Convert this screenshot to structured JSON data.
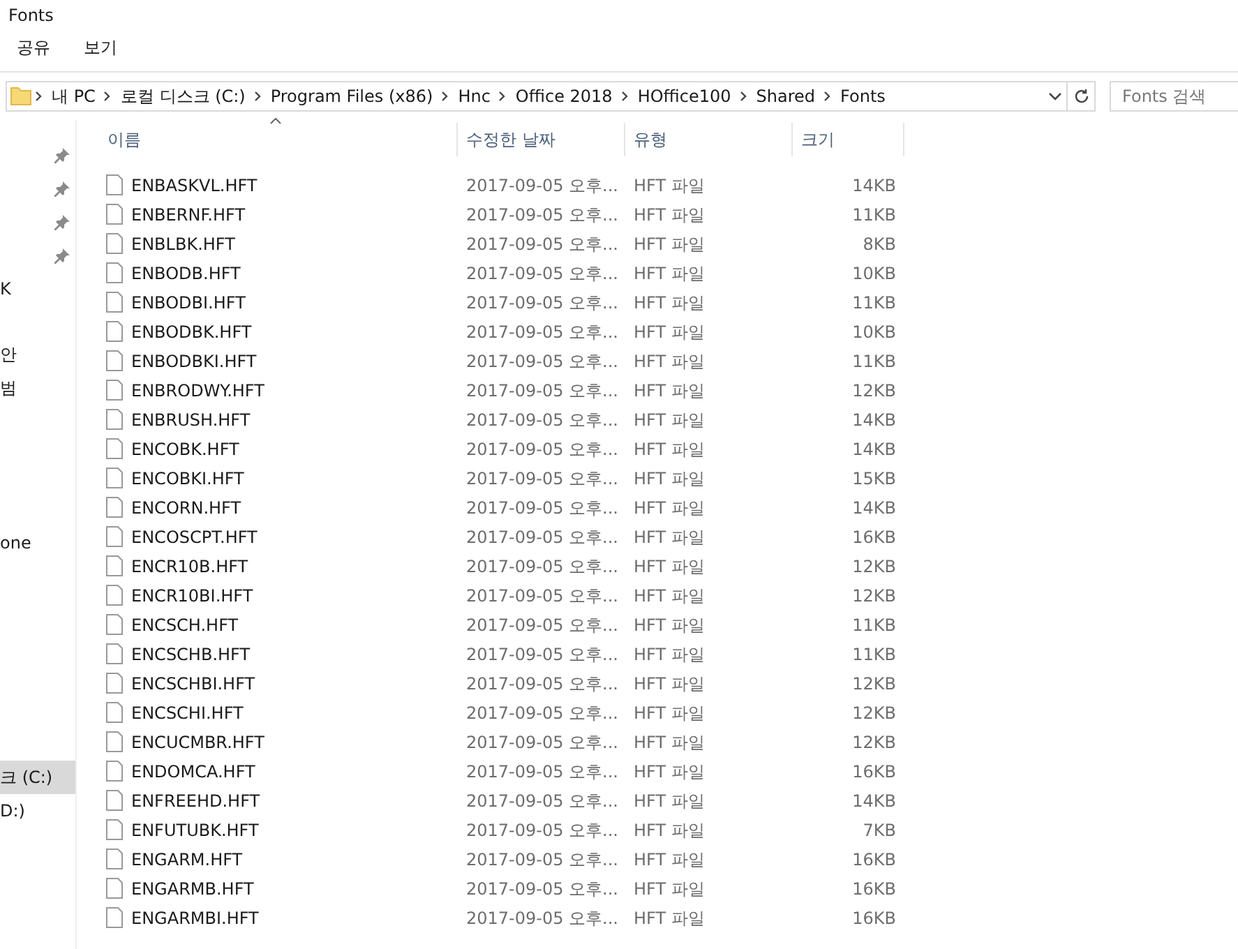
{
  "window": {
    "title": "Fonts"
  },
  "ribbon_tabs": [
    {
      "label": "공유",
      "selected": false
    },
    {
      "label": "보기",
      "selected": false
    }
  ],
  "address_bar": {
    "path": [
      "내 PC",
      "로컬 디스크 (C:)",
      "Program Files (x86)",
      "Hnc",
      "Office 2018",
      "HOffice100",
      "Shared",
      "Fonts"
    ]
  },
  "search": {
    "placeholder": "Fonts 검색"
  },
  "sidebar": {
    "groups": [
      {
        "items": [
          {
            "pinned": true,
            "selected": false
          },
          {
            "pinned": true,
            "selected": false
          },
          {
            "pinned": true,
            "selected": false
          },
          {
            "pinned": true,
            "selected": false
          },
          {
            "text": "K",
            "pinned": false,
            "selected": false
          }
        ]
      },
      {
        "items": [
          {
            "text": "안",
            "pinned": false,
            "selected": false
          },
          {
            "text": "범",
            "pinned": false,
            "selected": false
          }
        ]
      },
      {
        "items": [
          {
            "text": "one",
            "pinned": false,
            "selected": false
          }
        ]
      },
      {
        "items": [
          {
            "text": "크 (C:)",
            "pinned": false,
            "selected": true
          },
          {
            "text": "D:)",
            "pinned": false,
            "selected": false
          }
        ]
      }
    ]
  },
  "table": {
    "columns": [
      {
        "label": "이름",
        "sorted": true
      },
      {
        "label": "수정한 날짜",
        "sorted": false
      },
      {
        "label": "유형",
        "sorted": false
      },
      {
        "label": "크기",
        "sorted": false
      }
    ],
    "rows": [
      [
        "ENBASKVL.HFT",
        "2017-09-05 오후...",
        "HFT 파일",
        "14KB"
      ],
      [
        "ENBERNF.HFT",
        "2017-09-05 오후...",
        "HFT 파일",
        "11KB"
      ],
      [
        "ENBLBK.HFT",
        "2017-09-05 오후...",
        "HFT 파일",
        "8KB"
      ],
      [
        "ENBODB.HFT",
        "2017-09-05 오후...",
        "HFT 파일",
        "10KB"
      ],
      [
        "ENBODBI.HFT",
        "2017-09-05 오후...",
        "HFT 파일",
        "11KB"
      ],
      [
        "ENBODBK.HFT",
        "2017-09-05 오후...",
        "HFT 파일",
        "10KB"
      ],
      [
        "ENBODBKI.HFT",
        "2017-09-05 오후...",
        "HFT 파일",
        "11KB"
      ],
      [
        "ENBRODWY.HFT",
        "2017-09-05 오후...",
        "HFT 파일",
        "12KB"
      ],
      [
        "ENBRUSH.HFT",
        "2017-09-05 오후...",
        "HFT 파일",
        "14KB"
      ],
      [
        "ENCOBK.HFT",
        "2017-09-05 오후...",
        "HFT 파일",
        "14KB"
      ],
      [
        "ENCOBKI.HFT",
        "2017-09-05 오후...",
        "HFT 파일",
        "15KB"
      ],
      [
        "ENCORN.HFT",
        "2017-09-05 오후...",
        "HFT 파일",
        "14KB"
      ],
      [
        "ENCOSCPT.HFT",
        "2017-09-05 오후...",
        "HFT 파일",
        "16KB"
      ],
      [
        "ENCR10B.HFT",
        "2017-09-05 오후...",
        "HFT 파일",
        "12KB"
      ],
      [
        "ENCR10BI.HFT",
        "2017-09-05 오후...",
        "HFT 파일",
        "12KB"
      ],
      [
        "ENCSCH.HFT",
        "2017-09-05 오후...",
        "HFT 파일",
        "11KB"
      ],
      [
        "ENCSCHB.HFT",
        "2017-09-05 오후...",
        "HFT 파일",
        "11KB"
      ],
      [
        "ENCSCHBI.HFT",
        "2017-09-05 오후...",
        "HFT 파일",
        "12KB"
      ],
      [
        "ENCSCHI.HFT",
        "2017-09-05 오후...",
        "HFT 파일",
        "12KB"
      ],
      [
        "ENCUCMBR.HFT",
        "2017-09-05 오후...",
        "HFT 파일",
        "12KB"
      ],
      [
        "ENDOMCA.HFT",
        "2017-09-05 오후...",
        "HFT 파일",
        "16KB"
      ],
      [
        "ENFREEHD.HFT",
        "2017-09-05 오후...",
        "HFT 파일",
        "14KB"
      ],
      [
        "ENFUTUBK.HFT",
        "2017-09-05 오후...",
        "HFT 파일",
        "7KB"
      ],
      [
        "ENGARM.HFT",
        "2017-09-05 오후...",
        "HFT 파일",
        "16KB"
      ],
      [
        "ENGARMB.HFT",
        "2017-09-05 오후...",
        "HFT 파일",
        "16KB"
      ],
      [
        "ENGARMBI.HFT",
        "2017-09-05 오후...",
        "HFT 파일",
        "16KB"
      ]
    ]
  }
}
